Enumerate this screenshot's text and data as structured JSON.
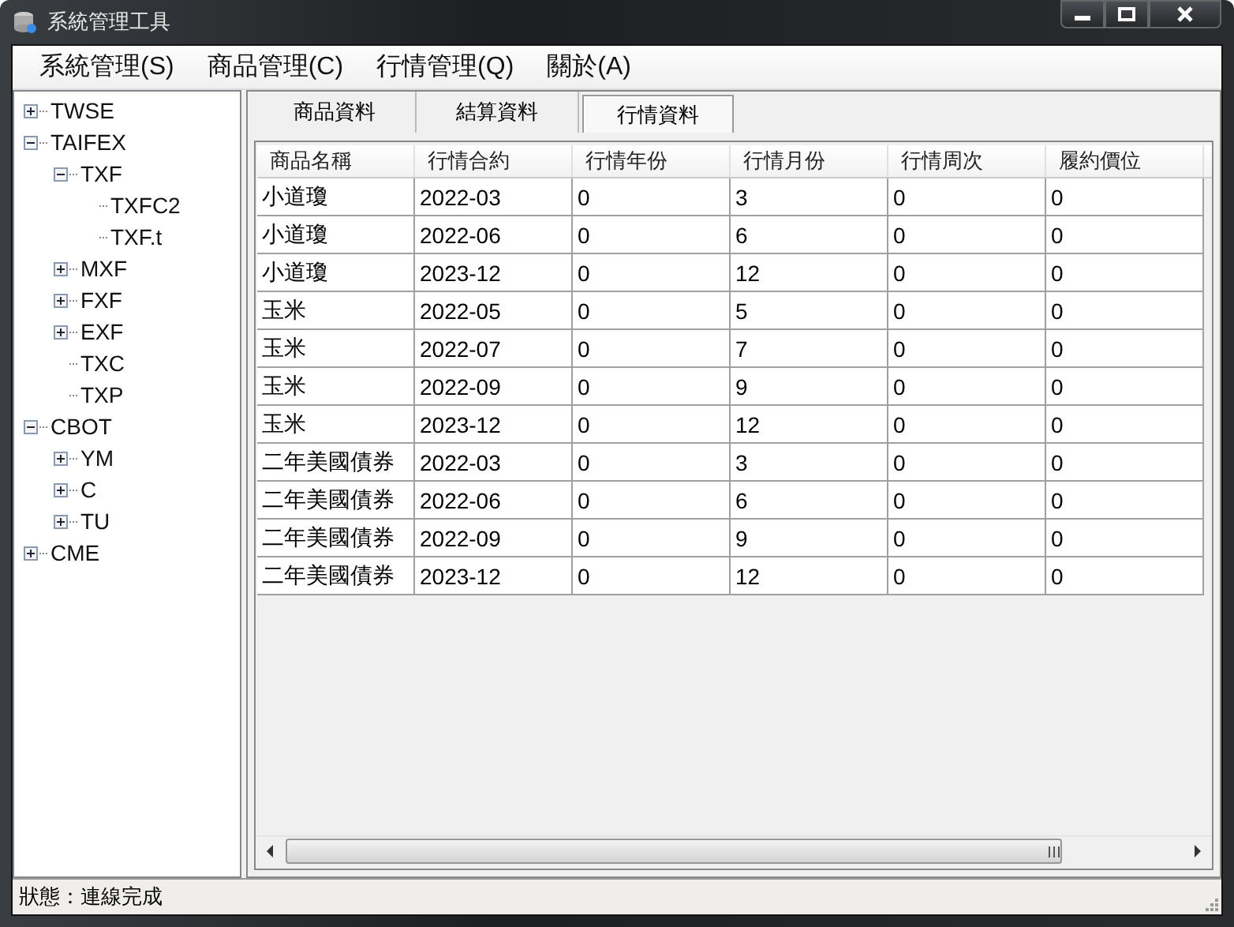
{
  "window": {
    "title": "系統管理工具"
  },
  "menu": [
    "系統管理(S)",
    "商品管理(C)",
    "行情管理(Q)",
    "關於(A)"
  ],
  "tree": [
    {
      "label": "TWSE",
      "expanded": false
    },
    {
      "label": "TAIFEX",
      "expanded": true,
      "children": [
        {
          "label": "TXF",
          "expanded": true,
          "children": [
            {
              "label": "TXFC2"
            },
            {
              "label": "TXF.t"
            }
          ]
        },
        {
          "label": "MXF",
          "expanded": false
        },
        {
          "label": "FXF",
          "expanded": false
        },
        {
          "label": "EXF",
          "expanded": false
        },
        {
          "label": "TXC"
        },
        {
          "label": "TXP"
        }
      ]
    },
    {
      "label": "CBOT",
      "expanded": true,
      "children": [
        {
          "label": "YM",
          "expanded": false
        },
        {
          "label": "C",
          "expanded": false
        },
        {
          "label": "TU",
          "expanded": false
        }
      ]
    },
    {
      "label": "CME",
      "expanded": false
    }
  ],
  "tabs": [
    {
      "label": "商品資料",
      "selected": false
    },
    {
      "label": "結算資料",
      "selected": false
    },
    {
      "label": "行情資料",
      "selected": true
    }
  ],
  "table": {
    "columns": [
      "商品名稱",
      "行情合約",
      "行情年份",
      "行情月份",
      "行情周次",
      "履約價位"
    ],
    "rows": [
      [
        "小道瓊",
        "2022-03",
        "0",
        "3",
        "0",
        "0"
      ],
      [
        "小道瓊",
        "2022-06",
        "0",
        "6",
        "0",
        "0"
      ],
      [
        "小道瓊",
        "2023-12",
        "0",
        "12",
        "0",
        "0"
      ],
      [
        "玉米",
        "2022-05",
        "0",
        "5",
        "0",
        "0"
      ],
      [
        "玉米",
        "2022-07",
        "0",
        "7",
        "0",
        "0"
      ],
      [
        "玉米",
        "2022-09",
        "0",
        "9",
        "0",
        "0"
      ],
      [
        "玉米",
        "2023-12",
        "0",
        "12",
        "0",
        "0"
      ],
      [
        "二年美國債券",
        "2022-03",
        "0",
        "3",
        "0",
        "0"
      ],
      [
        "二年美國債券",
        "2022-06",
        "0",
        "6",
        "0",
        "0"
      ],
      [
        "二年美國債券",
        "2022-09",
        "0",
        "9",
        "0",
        "0"
      ],
      [
        "二年美國債券",
        "2023-12",
        "0",
        "12",
        "0",
        "0"
      ]
    ]
  },
  "status_bar": "狀態：連線完成"
}
